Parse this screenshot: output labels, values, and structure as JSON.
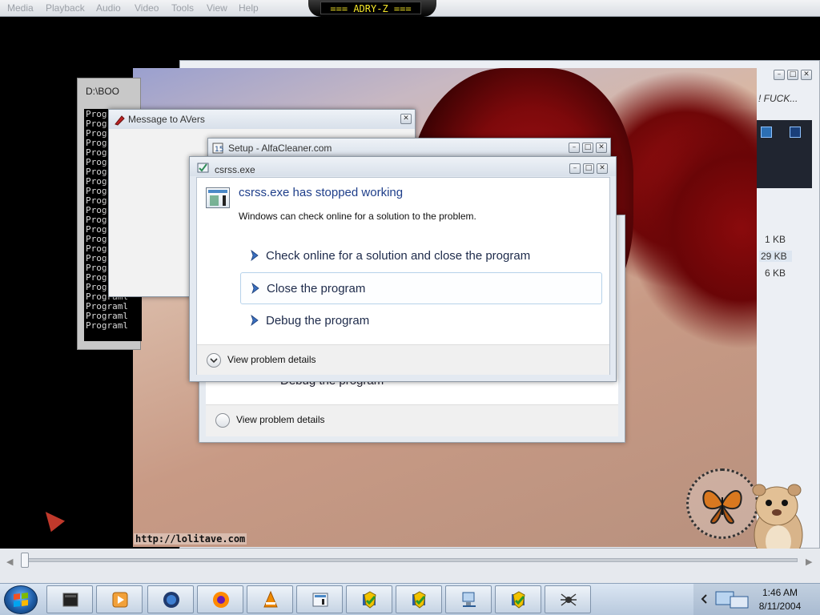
{
  "player": {
    "menus": [
      "Media",
      "Playback",
      "Audio",
      "Video",
      "Tools",
      "View",
      "Help"
    ],
    "title": "=== ADRY-Z ==="
  },
  "background_window": {
    "truncated_text": "! FUCK...",
    "file_sizes": [
      "1 KB",
      "29 KB",
      "6 KB"
    ]
  },
  "image_caption": "http://lolitave.com",
  "console": {
    "title": "D:\\BOO",
    "lines": [
      "Prog",
      "Prog",
      "Prog",
      "Prog",
      "Prog",
      "Prog",
      "Prog",
      "Prog",
      "Prog",
      "Prog",
      "Prog",
      "Prog",
      "Prog",
      "Prog",
      "Prog",
      "Prog",
      "Prog",
      "Prog",
      "Prog",
      "Programl",
      "Programl",
      "Programl",
      "Programl"
    ]
  },
  "message_window": {
    "title": "Message to AVers"
  },
  "setup_window": {
    "title": "Setup - AlfaCleaner.com",
    "ghost_option": "Debug the program",
    "ghost_details": "View problem details"
  },
  "error_dialog": {
    "title": "csrss.exe",
    "heading": "csrss.exe has stopped working",
    "subtext": "Windows can check online for a solution to the problem.",
    "options": [
      {
        "label": "Check online for a solution and close the program",
        "selected": false
      },
      {
        "label": "Close the program",
        "selected": true
      },
      {
        "label": "Debug the program",
        "selected": false
      }
    ],
    "details_label": "View problem details"
  },
  "tray": {
    "time": "1:46 AM",
    "date": "8/11/2004"
  },
  "taskbar": {
    "buttons": [
      "console-app-icon",
      "media-player-icon",
      "firefox-old-icon",
      "firefox-icon",
      "vlc-icon",
      "program-window-icon",
      "shield-check-icon",
      "shield-check-icon",
      "network-computer-icon",
      "shield-check-icon",
      "spider-icon"
    ]
  },
  "colors": {
    "accent_blue": "#1e3e8a",
    "rose_red": "#8a0a0c",
    "seek_title_yellow": "#f6e82a"
  }
}
